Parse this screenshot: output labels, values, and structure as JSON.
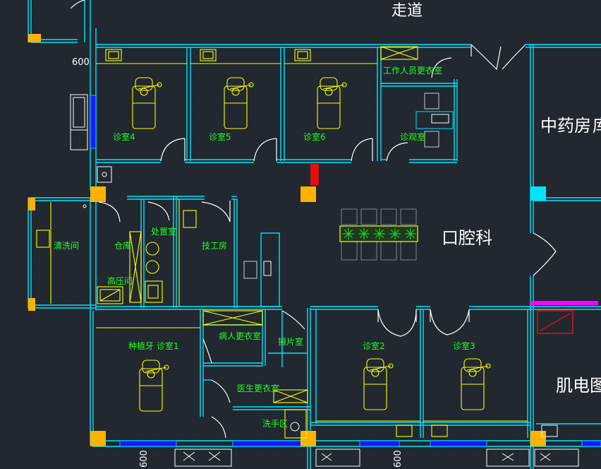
{
  "labels": {
    "corridor": "走道",
    "pharmacy": "中药房",
    "pharmacy_suffix": "库",
    "dental_dept": "口腔科",
    "emg_room": "肌电图",
    "exam_room_4": "诊室4",
    "exam_room_5": "诊室5",
    "exam_room_6": "诊室6",
    "staff_change": "工作人员更衣室",
    "consult_room": "诊观室",
    "cleaning_room": "清洗间",
    "storage": "仓库",
    "disposal_room": "处置室",
    "technician_room": "技工房",
    "autoclave_room": "高压间",
    "dental_room_1": "种植牙 诊室1",
    "patient_change": "病人更衣室",
    "exam_room_2": "诊室2",
    "exam_room_3": "诊室3",
    "doctor_change": "医生更衣室",
    "handwash": "洗手区",
    "xray_room": "摄片室",
    "dim_600_top": "600",
    "dim_600_bottom_left": "600",
    "dim_600_bottom_mid": "600"
  },
  "colors": {
    "background": "#212830",
    "wall": "#00e5ff",
    "furniture": "#ffff00",
    "column": "#ffb300",
    "room_text": "#22ff22",
    "window": "#1a1aff",
    "door": "#ffffff",
    "plant": "#22cc22",
    "highlight_red": "#e01010",
    "highlight_magenta": "#ff00ff"
  }
}
